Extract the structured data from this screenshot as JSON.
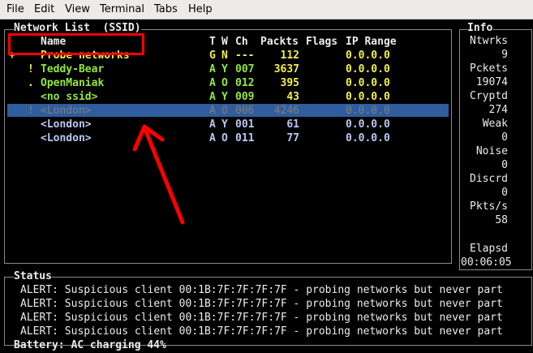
{
  "menu": [
    "File",
    "Edit",
    "View",
    "Terminal",
    "Tabs",
    "Help"
  ],
  "network_panel": {
    "title": "Network List  (SSID)",
    "headers": {
      "name": "Name",
      "type": "T",
      "wep": "W",
      "channel": "Ch",
      "packets": "Packts",
      "flags": "Flags",
      "ip_range": "IP Range"
    },
    "rows": [
      {
        "mark": "+",
        "name": "Probe networks",
        "type": "G",
        "wep": "N",
        "channel": "---",
        "packets": "112",
        "flags": "",
        "ip": "0.0.0.0"
      },
      {
        "mark": "!",
        "name": "Teddy-Bear",
        "type": "A",
        "wep": "Y",
        "channel": "007",
        "packets": "3637",
        "flags": "",
        "ip": "0.0.0.0"
      },
      {
        "mark": ".",
        "name": "OpenManiak",
        "type": "A",
        "wep": "O",
        "channel": "012",
        "packets": "395",
        "flags": "",
        "ip": "0.0.0.0"
      },
      {
        "mark": "",
        "name": "<no ssid>",
        "type": "A",
        "wep": "Y",
        "channel": "009",
        "packets": "43",
        "flags": "",
        "ip": "0.0.0.0"
      },
      {
        "mark": "!",
        "name": "<London>",
        "type": "A",
        "wep": "O",
        "channel": "006",
        "packets": "4246",
        "flags": "",
        "ip": "0.0.0.0"
      },
      {
        "mark": "",
        "name": "<London>",
        "type": "A",
        "wep": "Y",
        "channel": "001",
        "packets": "61",
        "flags": "",
        "ip": "0.0.0.0"
      },
      {
        "mark": "",
        "name": "<London>",
        "type": "A",
        "wep": "O",
        "channel": "011",
        "packets": "77",
        "flags": "",
        "ip": "0.0.0.0"
      }
    ],
    "selected_row": 4
  },
  "info_panel": {
    "title": "Info",
    "items": [
      {
        "label": "Ntwrks",
        "value": "9"
      },
      {
        "label": "Pckets",
        "value": "19074"
      },
      {
        "label": "Cryptd",
        "value": "274"
      },
      {
        "label": "Weak",
        "value": "0"
      },
      {
        "label": "Noise",
        "value": "0"
      },
      {
        "label": "Discrd",
        "value": "0"
      },
      {
        "label": "Pkts/s",
        "value": "58"
      }
    ],
    "elapsed_label": "Elapsd",
    "elapsed_value": "00:06:05"
  },
  "status_panel": {
    "title": "Status",
    "lines": [
      "ALERT: Suspicious client 00:1B:7F:7F:7F:7F - probing networks but never part",
      "ALERT: Suspicious client 00:1B:7F:7F:7F:7F - probing networks but never part",
      "ALERT: Suspicious client 00:1B:7F:7F:7F:7F - probing networks but never part",
      "ALERT: Suspicious client 00:1B:7F:7F:7F:7F - probing networks but never part"
    ]
  },
  "battery": "Battery: AC charging 44%",
  "colors": {
    "annotation": "#ff0000",
    "selection": "#2f5d9e",
    "highlight_text": "#f3ef4a",
    "network_text": "#93e83c",
    "probe_text": "#b8c8f2"
  }
}
